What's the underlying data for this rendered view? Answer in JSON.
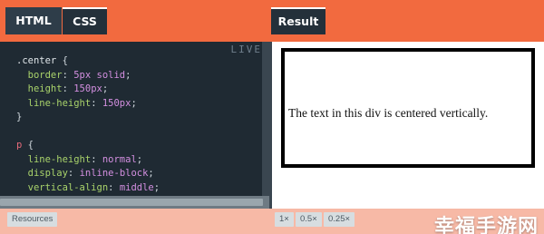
{
  "tabs": {
    "html_label": "HTML",
    "css_label": "CSS",
    "result_label": "Result"
  },
  "editor": {
    "live_label": "LIVE",
    "lines": [
      {
        "parts": [
          {
            "t": ".center ",
            "c": "sel"
          },
          {
            "t": "{",
            "c": "punc"
          }
        ]
      },
      {
        "parts": [
          {
            "t": "  border",
            "c": "prop"
          },
          {
            "t": ": ",
            "c": "punc"
          },
          {
            "t": "5px solid",
            "c": "val"
          },
          {
            "t": ";",
            "c": "punc"
          }
        ]
      },
      {
        "parts": [
          {
            "t": "  height",
            "c": "prop"
          },
          {
            "t": ": ",
            "c": "punc"
          },
          {
            "t": "150px",
            "c": "val"
          },
          {
            "t": ";",
            "c": "punc"
          }
        ]
      },
      {
        "parts": [
          {
            "t": "  line-height",
            "c": "prop"
          },
          {
            "t": ": ",
            "c": "punc"
          },
          {
            "t": "150px",
            "c": "val"
          },
          {
            "t": ";",
            "c": "punc"
          }
        ]
      },
      {
        "parts": [
          {
            "t": "}",
            "c": "punc"
          }
        ]
      },
      {
        "parts": []
      },
      {
        "parts": [
          {
            "t": "p ",
            "c": "tag"
          },
          {
            "t": "{",
            "c": "punc"
          }
        ]
      },
      {
        "parts": [
          {
            "t": "  line-height",
            "c": "prop"
          },
          {
            "t": ": ",
            "c": "punc"
          },
          {
            "t": "normal",
            "c": "val"
          },
          {
            "t": ";",
            "c": "punc"
          }
        ]
      },
      {
        "parts": [
          {
            "t": "  display",
            "c": "prop"
          },
          {
            "t": ": ",
            "c": "punc"
          },
          {
            "t": "inline-block",
            "c": "val"
          },
          {
            "t": ";",
            "c": "punc"
          }
        ]
      },
      {
        "parts": [
          {
            "t": "  vertical-align",
            "c": "prop"
          },
          {
            "t": ": ",
            "c": "punc"
          },
          {
            "t": "middle",
            "c": "val"
          },
          {
            "t": ";",
            "c": "punc"
          }
        ]
      },
      {
        "parts": [
          {
            "t": "}",
            "c": "punc"
          }
        ]
      }
    ]
  },
  "result": {
    "text": "The text in this div is centered vertically."
  },
  "bottom": {
    "resources_label": "Resources",
    "zoom_1x": "1×",
    "zoom_05x": "0.5×",
    "zoom_025x": "0.25×"
  },
  "watermark": "幸福手游网",
  "colors": {
    "accent": "#f26a3f",
    "editor_bg": "#1f2a33",
    "tab_bg": "#24303a"
  }
}
